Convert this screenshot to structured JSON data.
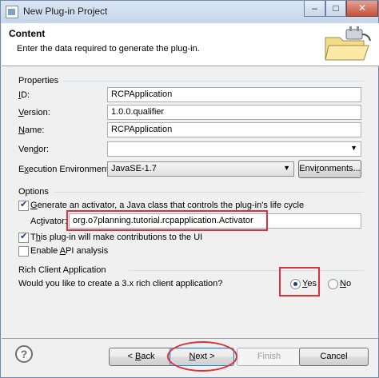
{
  "window": {
    "title": "New Plug-in Project",
    "minimize_label": "–",
    "maximize_label": "□",
    "close_label": "✕"
  },
  "header": {
    "title": "Content",
    "description": "Enter the data required to generate the plug-in."
  },
  "properties": {
    "group_label": "Properties",
    "id": {
      "label_accel": "I",
      "label_rest": "D:",
      "value": "RCPApplication"
    },
    "version": {
      "label_accel": "V",
      "label_rest": "ersion:",
      "value": "1.0.0.qualifier"
    },
    "name": {
      "label_accel": "N",
      "label_rest": "ame:",
      "value": "RCPApplication"
    },
    "vendor": {
      "label_pre": "Ven",
      "label_accel": "d",
      "label_rest": "or:",
      "value": ""
    },
    "exec_env": {
      "label_pre": "E",
      "label_accel": "x",
      "label_rest": "ecution Environment:",
      "value": "JavaSE-1.7",
      "button_pre": "Envi",
      "button_accel": "r",
      "button_rest": "onments..."
    }
  },
  "options": {
    "group_label": "Options",
    "generate_activator": {
      "checked": true,
      "label_accel": "G",
      "label_rest": "enerate an activator, a Java class that controls the plug-in's life cycle"
    },
    "activator": {
      "label_pre": "Ac",
      "label_accel": "t",
      "label_rest": "ivator:",
      "value": "org.o7planning.tutorial.rcpapplication.Activator"
    },
    "contributions": {
      "checked": true,
      "label_pre": "T",
      "label_accel": "h",
      "label_rest": "is plug-in will make contributions to the UI"
    },
    "api_analysis": {
      "checked": false,
      "label_pre": "Enable ",
      "label_accel": "A",
      "label_rest": "PI analysis"
    }
  },
  "rcp": {
    "group_label": "Rich Client Application",
    "question": "Would you like to create a 3.x rich client application?",
    "yes": {
      "accel": "Y",
      "rest": "es",
      "selected": true
    },
    "no": {
      "accel": "N",
      "rest": "o",
      "selected": false
    }
  },
  "footer": {
    "help_label": "?",
    "back": {
      "pre": "< ",
      "accel": "B",
      "rest": "ack"
    },
    "next": {
      "accel": "N",
      "rest": "ext >"
    },
    "finish": "Finish",
    "cancel": "Cancel"
  },
  "colors": {
    "highlight_red": "#d9323a",
    "header_bg": "#ffffff",
    "dialog_bg": "#f0f0f0"
  }
}
